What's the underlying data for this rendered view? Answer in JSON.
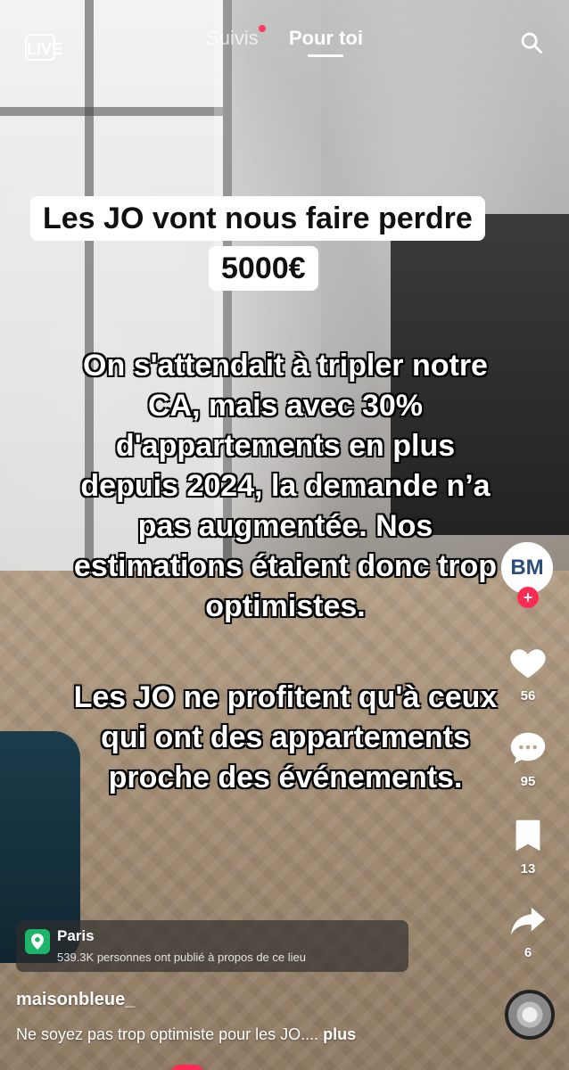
{
  "top_nav": {
    "live_label": "LIVE",
    "tabs": [
      {
        "label": "Suivis"
      },
      {
        "label": "Pour toi"
      }
    ]
  },
  "video": {
    "title_line_1": "Les JO vont nous faire perdre",
    "title_line_2": "5000€",
    "overlay_text_top": "On s'attendait à tripler notre\nCA, mais avec 30%\nd'appartements en plus\ndepuis 2024, la demande n’a\npas augmentée. Nos\nestimations étaient donc trop\noptimistes.",
    "overlay_text_bottom": "Les JO ne profitent qu'à ceux\nqui ont des appartements\nproche des événements."
  },
  "actions": {
    "avatar_text": "BM",
    "likes": "56",
    "comments": "95",
    "saves": "13",
    "shares": "6"
  },
  "location": {
    "title": "Paris",
    "subtitle": "539.3K personnes ont publié à propos de ce lieu"
  },
  "post": {
    "username": "maisonbleue_",
    "caption": "Ne soyez pas trop optimiste pour les JO....",
    "more_label": "plus"
  },
  "colors": {
    "accent": "#fe2c55",
    "location_icon": "#1db56a"
  },
  "icons": {
    "live": "live-icon",
    "search": "search-icon",
    "like": "heart-icon",
    "comment": "comment-icon",
    "save": "bookmark-icon",
    "share": "share-icon",
    "location": "location-pin-icon",
    "music": "music-disc-icon"
  }
}
